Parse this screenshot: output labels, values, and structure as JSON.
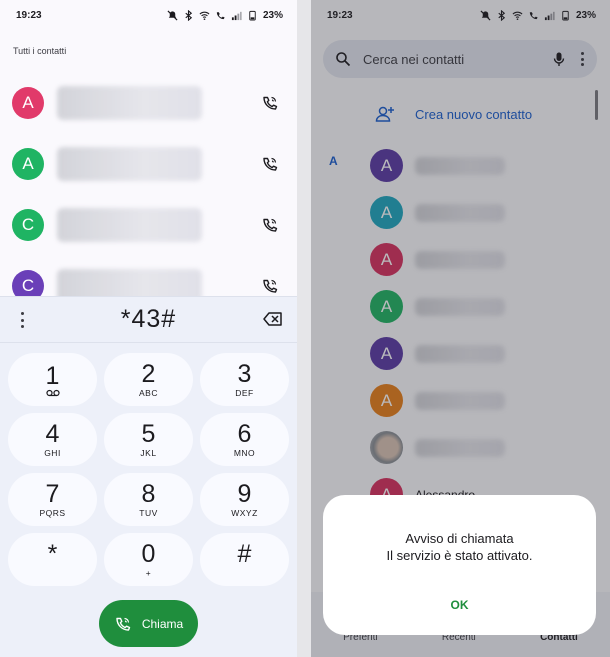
{
  "left_screen": {
    "status": {
      "time": "19:23",
      "battery": "23%"
    },
    "section_title": "Tutti i contatti",
    "contacts": [
      {
        "initial": "A",
        "color": "#e13a6a"
      },
      {
        "initial": "A",
        "color": "#1fb463"
      },
      {
        "initial": "C",
        "color": "#1fb463"
      },
      {
        "initial": "C",
        "color": "#6a3fb8"
      }
    ],
    "dial_number": "*43#",
    "keys": [
      {
        "digit": "1",
        "letters": ""
      },
      {
        "digit": "2",
        "letters": "ABC"
      },
      {
        "digit": "3",
        "letters": "DEF"
      },
      {
        "digit": "4",
        "letters": "GHI"
      },
      {
        "digit": "5",
        "letters": "JKL"
      },
      {
        "digit": "6",
        "letters": "MNO"
      },
      {
        "digit": "7",
        "letters": "PQRS"
      },
      {
        "digit": "8",
        "letters": "TUV"
      },
      {
        "digit": "9",
        "letters": "WXYZ"
      },
      {
        "digit": "*",
        "letters": ""
      },
      {
        "digit": "0",
        "letters": "+"
      },
      {
        "digit": "#",
        "letters": ""
      }
    ],
    "call_label": "Chiama",
    "call_color": "#1f8e3d"
  },
  "right_screen": {
    "status": {
      "time": "19:23",
      "battery": "23%"
    },
    "search_placeholder": "Cerca nei contatti",
    "new_contact_label": "Crea nuovo contatto",
    "section_letter": "A",
    "contacts": [
      {
        "initial": "A",
        "color": "#5a3aa6"
      },
      {
        "initial": "A",
        "color": "#1ea7c0"
      },
      {
        "initial": "A",
        "color": "#d8305f"
      },
      {
        "initial": "A",
        "color": "#1fb463"
      },
      {
        "initial": "A",
        "color": "#5a3aa6"
      },
      {
        "initial": "A",
        "color": "#e87f1a"
      },
      {
        "initial": "",
        "color": ""
      },
      {
        "initial": "A",
        "color": "#d8305f",
        "name_visible": "Alessandro"
      }
    ],
    "nav": {
      "favorites": "Preferiti",
      "recents": "Recenti",
      "contacts": "Contatti"
    },
    "dialog": {
      "title": "Avviso di chiamata",
      "message": "Il servizio è stato attivato.",
      "ok_label": "OK"
    }
  }
}
